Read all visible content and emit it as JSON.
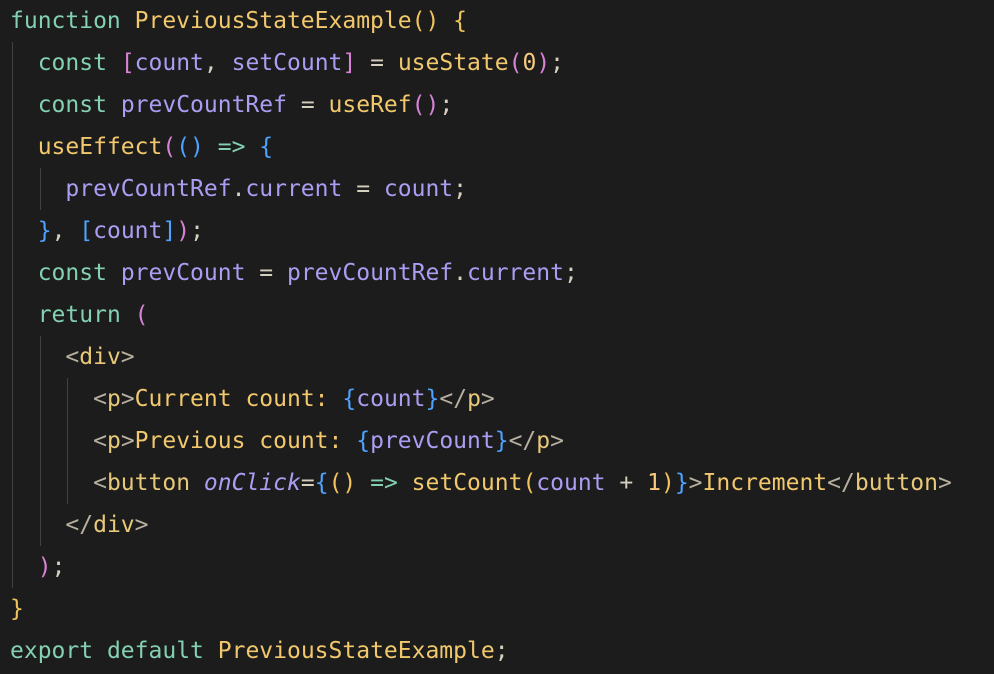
{
  "editor": {
    "language": "javascript",
    "lines": [
      {
        "indent": 0,
        "tokens": [
          {
            "t": "function",
            "c": "kw"
          },
          {
            "t": " ",
            "c": ""
          },
          {
            "t": "PreviousStateExample",
            "c": "fn"
          },
          {
            "t": "()",
            "c": "b1"
          },
          {
            "t": " ",
            "c": ""
          },
          {
            "t": "{",
            "c": "b1"
          }
        ]
      },
      {
        "indent": 1,
        "tokens": [
          {
            "t": "const",
            "c": "kw"
          },
          {
            "t": " ",
            "c": ""
          },
          {
            "t": "[",
            "c": "b2"
          },
          {
            "t": "count",
            "c": "var"
          },
          {
            "t": ", ",
            "c": "punc"
          },
          {
            "t": "setCount",
            "c": "var"
          },
          {
            "t": "]",
            "c": "b2"
          },
          {
            "t": " = ",
            "c": "op"
          },
          {
            "t": "useState",
            "c": "fn"
          },
          {
            "t": "(",
            "c": "b2"
          },
          {
            "t": "0",
            "c": "num"
          },
          {
            "t": ")",
            "c": "b2"
          },
          {
            "t": ";",
            "c": "punc"
          }
        ]
      },
      {
        "indent": 1,
        "tokens": [
          {
            "t": "const",
            "c": "kw"
          },
          {
            "t": " ",
            "c": ""
          },
          {
            "t": "prevCountRef",
            "c": "var"
          },
          {
            "t": " = ",
            "c": "op"
          },
          {
            "t": "useRef",
            "c": "fn"
          },
          {
            "t": "()",
            "c": "b2"
          },
          {
            "t": ";",
            "c": "punc"
          }
        ]
      },
      {
        "indent": 1,
        "tokens": [
          {
            "t": "useEffect",
            "c": "fn"
          },
          {
            "t": "(",
            "c": "b2"
          },
          {
            "t": "()",
            "c": "b3"
          },
          {
            "t": " => ",
            "c": "kw"
          },
          {
            "t": "{",
            "c": "b3"
          }
        ]
      },
      {
        "indent": 2,
        "tokens": [
          {
            "t": "prevCountRef",
            "c": "var"
          },
          {
            "t": ".",
            "c": "punc"
          },
          {
            "t": "current",
            "c": "var"
          },
          {
            "t": " = ",
            "c": "op"
          },
          {
            "t": "count",
            "c": "var"
          },
          {
            "t": ";",
            "c": "punc"
          }
        ]
      },
      {
        "indent": 1,
        "tokens": [
          {
            "t": "}",
            "c": "b3"
          },
          {
            "t": ", ",
            "c": "punc"
          },
          {
            "t": "[",
            "c": "b3"
          },
          {
            "t": "count",
            "c": "var"
          },
          {
            "t": "]",
            "c": "b3"
          },
          {
            "t": ")",
            "c": "b2"
          },
          {
            "t": ";",
            "c": "punc"
          }
        ]
      },
      {
        "indent": 1,
        "tokens": [
          {
            "t": "const",
            "c": "kw"
          },
          {
            "t": " ",
            "c": ""
          },
          {
            "t": "prevCount",
            "c": "var"
          },
          {
            "t": " = ",
            "c": "op"
          },
          {
            "t": "prevCountRef",
            "c": "var"
          },
          {
            "t": ".",
            "c": "punc"
          },
          {
            "t": "current",
            "c": "var"
          },
          {
            "t": ";",
            "c": "punc"
          }
        ]
      },
      {
        "indent": 1,
        "tokens": [
          {
            "t": "return",
            "c": "kw"
          },
          {
            "t": " ",
            "c": ""
          },
          {
            "t": "(",
            "c": "b2"
          }
        ]
      },
      {
        "indent": 2,
        "tokens": [
          {
            "t": "<",
            "c": "tagb"
          },
          {
            "t": "div",
            "c": "tag"
          },
          {
            "t": ">",
            "c": "tagb"
          }
        ]
      },
      {
        "indent": 3,
        "tokens": [
          {
            "t": "<",
            "c": "tagb"
          },
          {
            "t": "p",
            "c": "tag"
          },
          {
            "t": ">",
            "c": "tagb"
          },
          {
            "t": "Current count: ",
            "c": "txt"
          },
          {
            "t": "{",
            "c": "b3"
          },
          {
            "t": "count",
            "c": "var"
          },
          {
            "t": "}",
            "c": "b3"
          },
          {
            "t": "</",
            "c": "tagb"
          },
          {
            "t": "p",
            "c": "tag"
          },
          {
            "t": ">",
            "c": "tagb"
          }
        ]
      },
      {
        "indent": 3,
        "tokens": [
          {
            "t": "<",
            "c": "tagb"
          },
          {
            "t": "p",
            "c": "tag"
          },
          {
            "t": ">",
            "c": "tagb"
          },
          {
            "t": "Previous count: ",
            "c": "txt"
          },
          {
            "t": "{",
            "c": "b3"
          },
          {
            "t": "prevCount",
            "c": "var"
          },
          {
            "t": "}",
            "c": "b3"
          },
          {
            "t": "</",
            "c": "tagb"
          },
          {
            "t": "p",
            "c": "tag"
          },
          {
            "t": ">",
            "c": "tagb"
          }
        ]
      },
      {
        "indent": 3,
        "tokens": [
          {
            "t": "<",
            "c": "tagb"
          },
          {
            "t": "button",
            "c": "tag"
          },
          {
            "t": " ",
            "c": ""
          },
          {
            "t": "onClick",
            "c": "attr"
          },
          {
            "t": "=",
            "c": "op"
          },
          {
            "t": "{",
            "c": "b3"
          },
          {
            "t": "()",
            "c": "b1"
          },
          {
            "t": " => ",
            "c": "kw"
          },
          {
            "t": "setCount",
            "c": "fn"
          },
          {
            "t": "(",
            "c": "b1"
          },
          {
            "t": "count",
            "c": "var"
          },
          {
            "t": " + ",
            "c": "op"
          },
          {
            "t": "1",
            "c": "num"
          },
          {
            "t": ")",
            "c": "b1"
          },
          {
            "t": "}",
            "c": "b3"
          },
          {
            "t": ">",
            "c": "tagb"
          },
          {
            "t": "Increment",
            "c": "txt"
          },
          {
            "t": "</",
            "c": "tagb"
          },
          {
            "t": "button",
            "c": "tag"
          },
          {
            "t": ">",
            "c": "tagb"
          }
        ]
      },
      {
        "indent": 2,
        "tokens": [
          {
            "t": "</",
            "c": "tagb"
          },
          {
            "t": "div",
            "c": "tag"
          },
          {
            "t": ">",
            "c": "tagb"
          }
        ]
      },
      {
        "indent": 1,
        "tokens": [
          {
            "t": ")",
            "c": "b2"
          },
          {
            "t": ";",
            "c": "punc"
          }
        ]
      },
      {
        "indent": 0,
        "tokens": [
          {
            "t": "}",
            "c": "b1"
          }
        ]
      },
      {
        "indent": 0,
        "tokens": [
          {
            "t": "export",
            "c": "kw"
          },
          {
            "t": " ",
            "c": ""
          },
          {
            "t": "default",
            "c": "kw"
          },
          {
            "t": " ",
            "c": ""
          },
          {
            "t": "PreviousStateExample",
            "c": "fn"
          },
          {
            "t": ";",
            "c": "punc"
          }
        ]
      }
    ]
  }
}
